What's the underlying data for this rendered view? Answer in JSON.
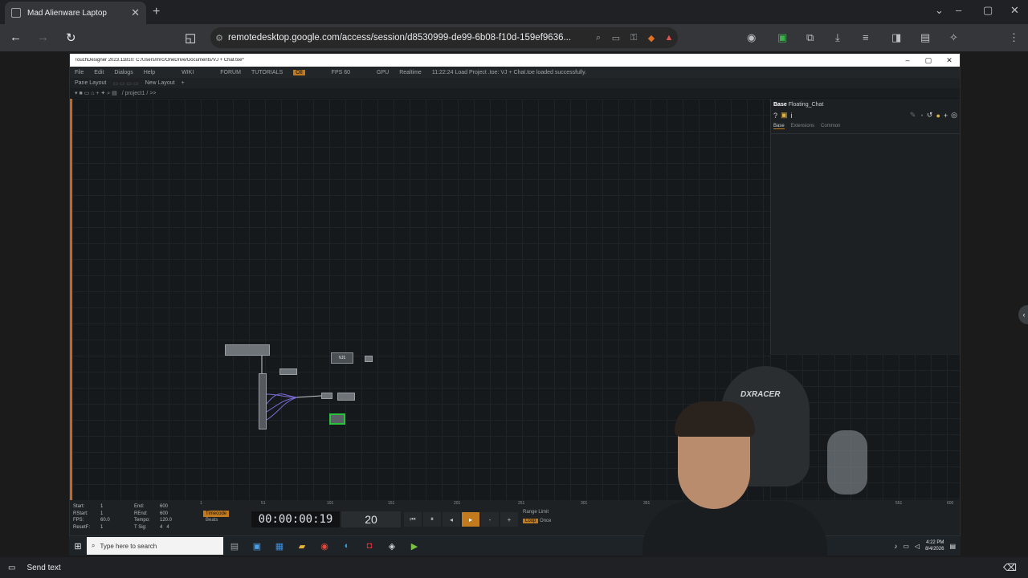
{
  "browser": {
    "tab_title": "Mad Alienware Laptop",
    "url": "remotedesktop.google.com/access/session/d8530999-de99-6b08-f10d-159ef9636..."
  },
  "td": {
    "title": "TouchDesigner 2023.11810: C:/Users/mrc/OneDrive/Documents/VJ + Chat.toe*",
    "menu": [
      "File",
      "Edit",
      "Dialogs",
      "Help"
    ],
    "links": [
      "WIKI",
      "FORUM",
      "TUTORIALS"
    ],
    "oll": "Oll",
    "fps_label": "FPS 60",
    "gpu": "GPU",
    "realtime": "Realtime",
    "status": "11:22:24 Load Project .toe: VJ + Chat.toe loaded successfully.",
    "pane_layout": "Pane Layout",
    "new_layout": "New Layout",
    "path": "/ project1 / >>",
    "params": {
      "type": "Base",
      "name": "Floating_Chat",
      "tabs": [
        "Base",
        "Extensions",
        "Common"
      ]
    },
    "node_vj": "VJ1"
  },
  "timeline": {
    "ruler": [
      "1",
      "51",
      "101",
      "151",
      "201",
      "251",
      "301",
      "351",
      "551",
      "600"
    ],
    "start_label": "Start:",
    "start": "1",
    "end_label": "End:",
    "end": "600",
    "rstart_label": "RStart:",
    "rstart": "1",
    "rend_label": "REnd:",
    "rend": "600",
    "fps_label": "FPS:",
    "fps": "60.0",
    "tempo_label": "Tempo:",
    "tempo": "120.0",
    "reset_label": "ResetF:",
    "reset": "1",
    "tsig_label": "T Sig:",
    "tsig_a": "4",
    "tsig_b": "4",
    "timecode_btn": "Timecode",
    "beats_btn": "Beats",
    "timecode": "00:00:00:19",
    "frame": "20",
    "range_limit": "Range Limit",
    "loop": "Loop",
    "once": "Once"
  },
  "taskbar": {
    "search_placeholder": "Type here to search",
    "time": "4:22 PM",
    "date": "8/4/2026"
  },
  "bottom": {
    "send_text": "Send text"
  },
  "webcam": {
    "chair_brand": "DXRACER"
  }
}
